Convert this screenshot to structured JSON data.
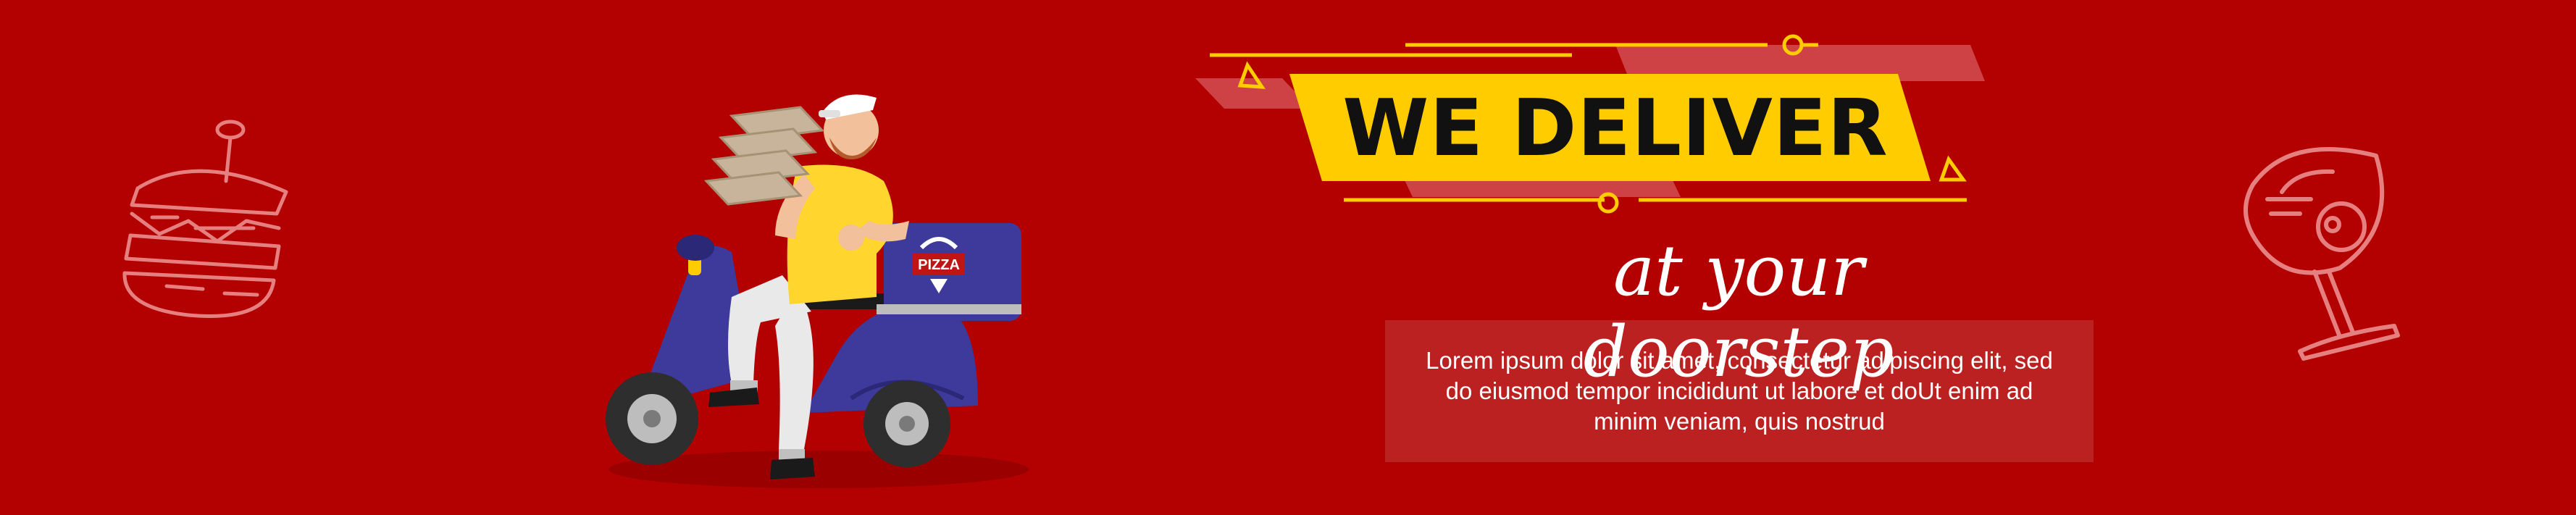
{
  "banner": {
    "headline": "WE DELIVER",
    "tagline": "at your doorstep",
    "body_text": "Lorem ipsum dolor sit amet, consectetur adipiscing elit, sed do eiusmod tempor incididunt ut labore et doUt enim ad minim veniam, quis nostrud",
    "delivery_box_label": "PIZZA",
    "colors": {
      "background": "#b30000",
      "accent_yellow": "#ffcc00",
      "scooter_blue": "#3d3a9c",
      "shirt_yellow": "#ffd52e"
    },
    "icons": [
      "burger-icon",
      "wine-glass-icon",
      "delivery-scooter-illustration"
    ]
  }
}
